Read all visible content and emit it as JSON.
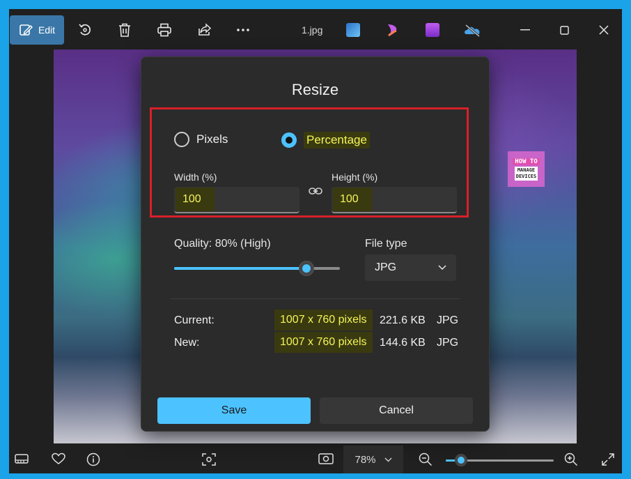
{
  "toolbar": {
    "edit_label": "Edit",
    "filename": "1.jpg",
    "icons": [
      "edit-icon",
      "rotate-icon",
      "delete-icon",
      "print-icon",
      "share-icon",
      "more-icon",
      "paint-icon",
      "clipchamp-icon",
      "video-editor-icon",
      "onedrive-icon",
      "minimize-icon",
      "maximize-icon",
      "close-icon"
    ]
  },
  "logo": {
    "line1": "HOW TO",
    "line2": "MANAGE",
    "line3": "DEVICES"
  },
  "dialog": {
    "title": "Resize",
    "radio_pixels": "Pixels",
    "radio_percentage": "Percentage",
    "selected_mode": "Percentage",
    "width_label": "Width  (%)",
    "width_value": "100",
    "height_label": "Height  (%)",
    "height_value": "100",
    "quality_label": "Quality: 80% (High)",
    "quality_value": 0.8,
    "file_type_label": "File type",
    "file_type_value": "JPG",
    "current_label": "Current:",
    "current_dims": "1007 x 760 pixels",
    "current_size": "221.6 KB",
    "current_type": "JPG",
    "new_label": "New:",
    "new_dims": "1007 x 760 pixels",
    "new_size": "144.6 KB",
    "new_type": "JPG",
    "save_label": "Save",
    "cancel_label": "Cancel"
  },
  "bottombar": {
    "zoom_label": "78%",
    "zoom_level": 0.14
  },
  "colors": {
    "accent": "#4cc2ff",
    "highlight_text": "#f5f55a",
    "annotation_red": "#d8202a"
  }
}
